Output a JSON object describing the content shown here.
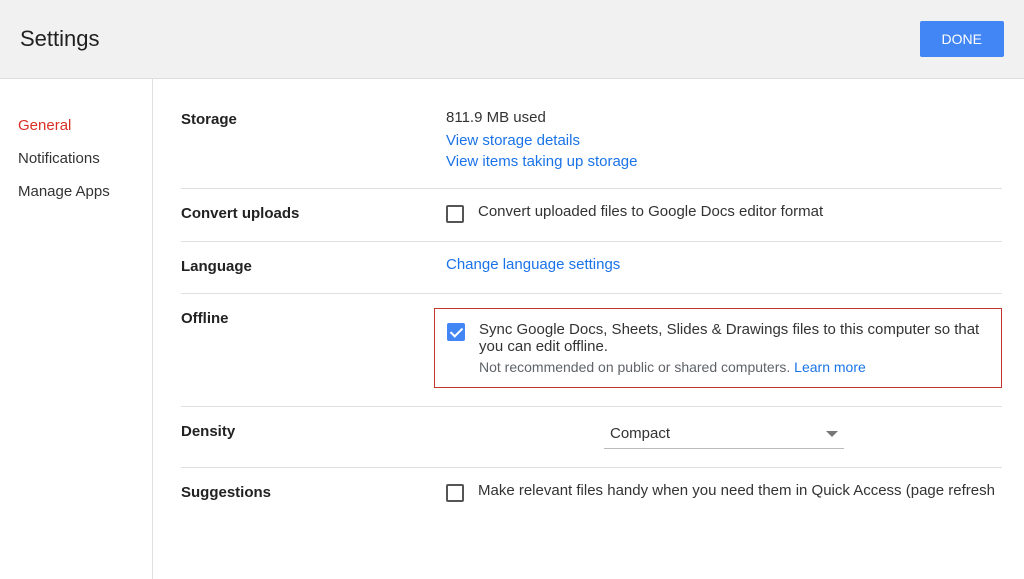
{
  "header": {
    "title": "Settings",
    "done_label": "DONE"
  },
  "sidebar": {
    "items": [
      {
        "label": "General",
        "active": true
      },
      {
        "label": "Notifications",
        "active": false
      },
      {
        "label": "Manage Apps",
        "active": false
      }
    ]
  },
  "sections": {
    "storage": {
      "label": "Storage",
      "used_text": "811.9 MB used",
      "link_details": "View storage details",
      "link_items": "View items taking up storage"
    },
    "convert": {
      "label": "Convert uploads",
      "checked": false,
      "text": "Convert uploaded files to Google Docs editor format"
    },
    "language": {
      "label": "Language",
      "link": "Change language settings"
    },
    "offline": {
      "label": "Offline",
      "checked": true,
      "text": "Sync Google Docs, Sheets, Slides & Drawings files to this computer so that you can edit offline.",
      "note_prefix": "Not recommended on public or shared computers. ",
      "learn_more": "Learn more"
    },
    "density": {
      "label": "Density",
      "value": "Compact"
    },
    "suggestions": {
      "label": "Suggestions",
      "checked": false,
      "text": "Make relevant files handy when you need them in Quick Access (page refresh"
    }
  }
}
